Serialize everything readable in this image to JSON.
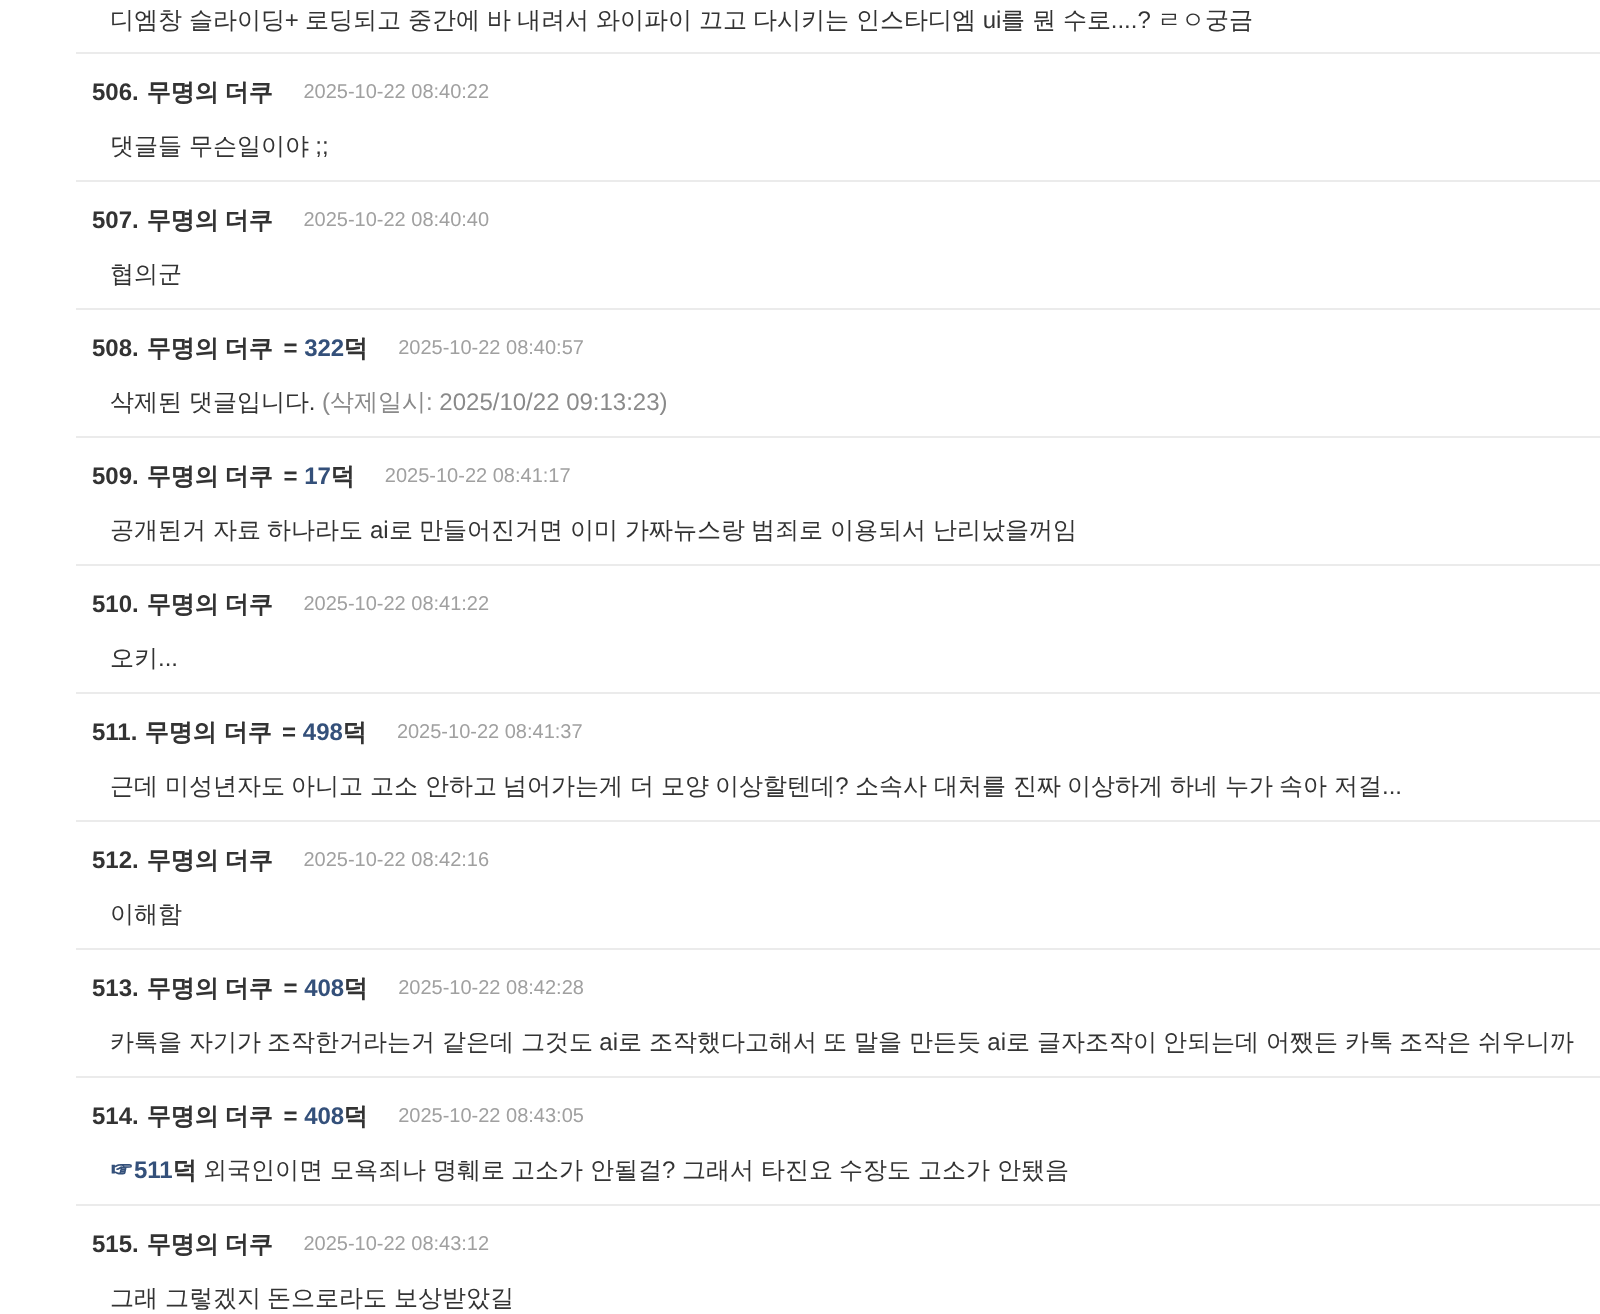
{
  "comments": [
    {
      "kind": "normal",
      "body": "디엠창 슬라이딩+ 로딩되고 중간에 바 내려서 와이파이 끄고 다시키는 인스타디엠 ui를 뭔 수로....? ㄹㅇ궁금"
    },
    {
      "kind": "normal",
      "number": "506.",
      "author": "무명의 더쿠",
      "timestamp": "2025-10-22 08:40:22",
      "body": "댓글들 무슨일이야 ;;"
    },
    {
      "kind": "normal",
      "number": "507.",
      "author": "무명의 더쿠",
      "timestamp": "2025-10-22 08:40:40",
      "body": "협의군"
    },
    {
      "kind": "deleted",
      "number": "508.",
      "author": "무명의 더쿠",
      "score": {
        "sign": "=",
        "value": "322",
        "unit": "덕"
      },
      "timestamp": "2025-10-22 08:40:57",
      "body": "삭제된 댓글입니다.",
      "deleted_info": "(삭제일시: 2025/10/22 09:13:23)"
    },
    {
      "kind": "normal",
      "number": "509.",
      "author": "무명의 더쿠",
      "score": {
        "sign": "=",
        "value": "17",
        "unit": "덕"
      },
      "timestamp": "2025-10-22 08:41:17",
      "body": "공개된거 자료 하나라도 ai로 만들어진거면 이미 가짜뉴스랑 범죄로 이용되서 난리났을꺼임"
    },
    {
      "kind": "normal",
      "number": "510.",
      "author": "무명의 더쿠",
      "timestamp": "2025-10-22 08:41:22",
      "body": "오키..."
    },
    {
      "kind": "normal",
      "number": "511.",
      "author": "무명의 더쿠",
      "score": {
        "sign": "=",
        "value": "498",
        "unit": "덕"
      },
      "timestamp": "2025-10-22 08:41:37",
      "body": "근데 미성년자도 아니고 고소 안하고 넘어가는게 더 모양 이상할텐데? 소속사 대처를 진짜 이상하게 하네 누가 속아 저걸..."
    },
    {
      "kind": "normal",
      "number": "512.",
      "author": "무명의 더쿠",
      "timestamp": "2025-10-22 08:42:16",
      "body": "이해함"
    },
    {
      "kind": "normal",
      "number": "513.",
      "author": "무명의 더쿠",
      "score": {
        "sign": "=",
        "value": "408",
        "unit": "덕"
      },
      "timestamp": "2025-10-22 08:42:28",
      "body": "카톡을 자기가 조작한거라는거 같은데 그것도 ai로 조작했다고해서 또 말을 만든듯 ai로 글자조작이 안되는데 어쨌든 카톡 조작은 쉬우니까"
    },
    {
      "kind": "reply",
      "number": "514.",
      "author": "무명의 더쿠",
      "score": {
        "sign": "=",
        "value": "408",
        "unit": "덕"
      },
      "timestamp": "2025-10-22 08:43:05",
      "reply": {
        "mark": "☞",
        "value": "511",
        "unit": "덕"
      },
      "body": "외국인이면 모욕죄나 명훼로 고소가 안될걸? 그래서 타진요 수장도 고소가 안됐음"
    },
    {
      "kind": "normal",
      "number": "515.",
      "author": "무명의 더쿠",
      "timestamp": "2025-10-22 08:43:12",
      "body": "그래 그렇겠지 돈으로라도 보상받았길"
    }
  ]
}
